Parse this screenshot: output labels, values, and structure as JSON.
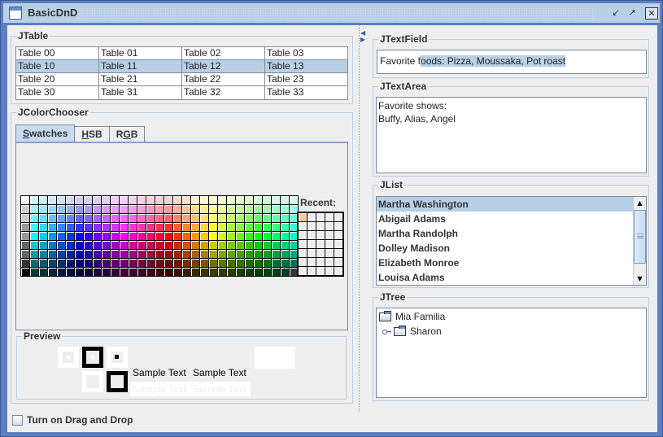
{
  "window": {
    "title": "BasicDnD",
    "controls": {
      "minimize": "↙",
      "maximize": "↗",
      "close": "✕"
    }
  },
  "jtable": {
    "title": "JTable",
    "selected_row": 1,
    "rows": [
      [
        "Table 00",
        "Table 01",
        "Table 02",
        "Table 03"
      ],
      [
        "Table 10",
        "Table 11",
        "Table 12",
        "Table 13"
      ],
      [
        "Table 20",
        "Table 21",
        "Table 22",
        "Table 23"
      ],
      [
        "Table 30",
        "Table 31",
        "Table 32",
        "Table 33"
      ]
    ]
  },
  "colorchooser": {
    "title": "JColorChooser",
    "tabs": [
      {
        "label_mnemonic": "S",
        "label_rest": "watches",
        "active": true
      },
      {
        "label_mnemonic": "H",
        "label_rest": "SB",
        "active": false
      },
      {
        "label_prefix": "R",
        "label_mnemonic": "G",
        "label_rest": "B",
        "active": false
      }
    ],
    "recent_label": "Recent:",
    "recent_first_color": "#ffcc99",
    "preview": {
      "title": "Preview",
      "sample_text": "Sample Text",
      "selected_color": "#ffffff"
    }
  },
  "textfield": {
    "title": "JTextField",
    "value_unselected": "Favorite f",
    "value_selected": "oods: Pizza, Moussaka, Pot roast"
  },
  "textarea": {
    "title": "JTextArea",
    "value": "Favorite shows:\nBuffy, Alias, Angel"
  },
  "jlist": {
    "title": "JList",
    "selected_index": 0,
    "items": [
      "Martha Washington",
      "Abigail Adams",
      "Martha Randolph",
      "Dolley Madison",
      "Elizabeth Monroe",
      "Louisa Adams"
    ],
    "scroll_up": "▲",
    "scroll_down": "▼"
  },
  "jtree": {
    "title": "JTree",
    "root": "Mia Familia",
    "children": [
      "Sharon"
    ]
  },
  "dnd_toggle": {
    "label": "Turn on Drag and Drop",
    "checked": false
  },
  "colors": {
    "selection": "#b8cfe5",
    "titlebar": "#b8cfe5",
    "frame": "#5c7fc0"
  }
}
